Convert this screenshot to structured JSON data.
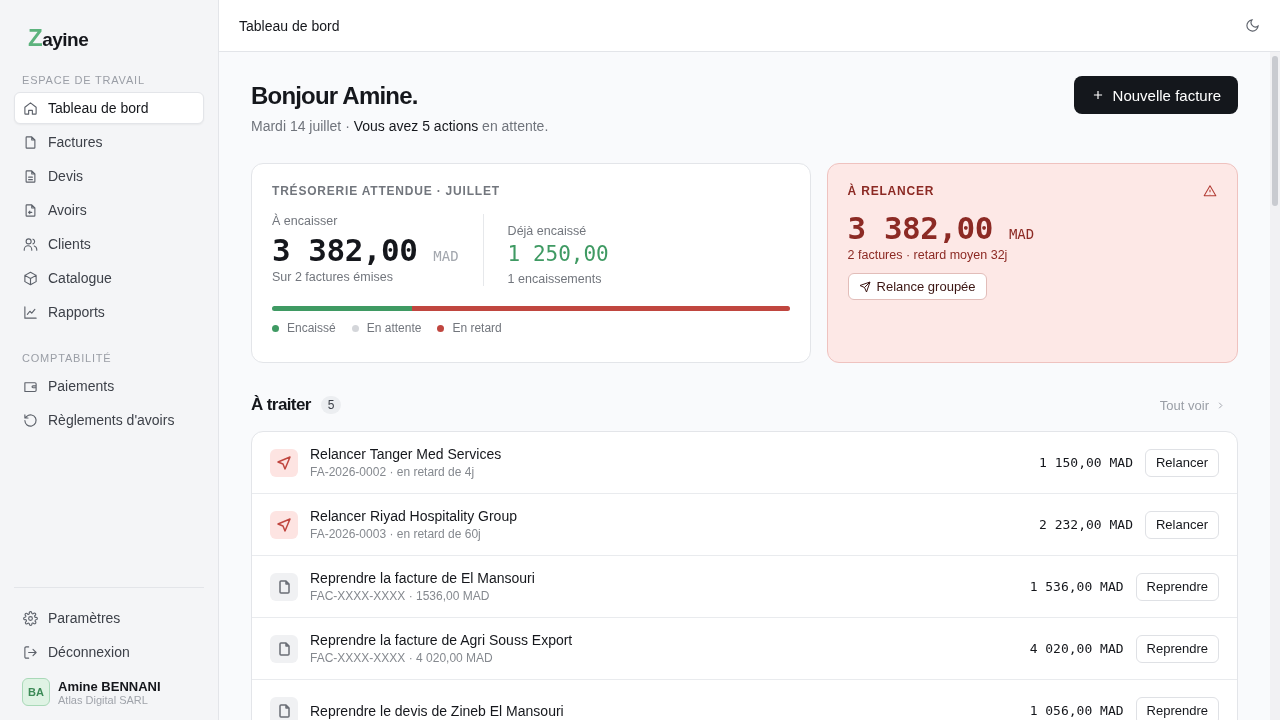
{
  "sidebar": {
    "logo": {
      "mark": "Z",
      "rest": "ayine"
    },
    "sections": [
      {
        "title": "ESPACE DE TRAVAIL",
        "items": [
          {
            "label": "Tableau de bord",
            "selected": true
          },
          {
            "label": "Factures",
            "selected": false
          },
          {
            "label": "Devis",
            "selected": false
          },
          {
            "label": "Avoirs",
            "selected": false
          },
          {
            "label": "Clients",
            "selected": false
          },
          {
            "label": "Catalogue",
            "selected": false
          },
          {
            "label": "Rapports",
            "selected": false
          }
        ]
      },
      {
        "title": "COMPTABILITÉ",
        "items": [
          {
            "label": "Paiements",
            "selected": false
          },
          {
            "label": "Règlements d'avoirs",
            "selected": false
          }
        ]
      }
    ],
    "footer": [
      {
        "label": "Paramètres"
      },
      {
        "label": "Déconnexion"
      }
    ],
    "user": {
      "initials": "BA",
      "name": "Amine BENNANI",
      "company": "Atlas Digital SARL"
    }
  },
  "topbar": {
    "title": "Tableau de bord"
  },
  "greeting": {
    "title": "Bonjour Amine.",
    "subtitle": "Mardi 14 juillet · **Vous avez 5 actions** en attente.",
    "button": "Nouvelle facture"
  },
  "treasury": {
    "title": "TRÉSORERIE ATTENDUE · JUILLET",
    "to_collect": {
      "label": "À encaisser",
      "amount": "3 382,00",
      "currency": "MAD",
      "note": "Sur 2 factures émises"
    },
    "collected": {
      "label": "Déjà encaissé",
      "amount": "1 250,00",
      "note": "1 encaissements"
    },
    "segments": [
      {
        "label": "Encaissé",
        "color": "#3f9a63",
        "level": 0.27
      },
      {
        "label": "En attente",
        "color": "#d4d6da",
        "level": 0
      },
      {
        "label": "En retard",
        "color": "#c0463f",
        "level": 0.73
      }
    ]
  },
  "reminder": {
    "title": "À RELANCER",
    "amount": "3 382,00",
    "currency": "MAD",
    "note": "2 factures · retard moyen 32j",
    "button": "Relance groupée"
  },
  "todo": {
    "title": "À traiter",
    "count": "5",
    "link": "Tout voir",
    "rows": [
      {
        "kind": "relance",
        "title": "Relancer Tanger Med Services",
        "sub": "FA-2026-0002 · en retard de 4j",
        "amount": "1 150,00 MAD",
        "action": "Relancer"
      },
      {
        "kind": "relance",
        "title": "Relancer Riyad Hospitality Group",
        "sub": "FA-2026-0003 · en retard de 60j",
        "amount": "2 232,00 MAD",
        "action": "Relancer"
      },
      {
        "kind": "reprise",
        "title": "Reprendre la facture de El Mansouri",
        "sub": "FAC-XXXX-XXXX · 1536,00 MAD",
        "amount": "1 536,00 MAD",
        "action": "Reprendre"
      },
      {
        "kind": "reprise",
        "title": "Reprendre la facture de Agri Souss Export",
        "sub": "FAC-XXXX-XXXX · 4 020,00 MAD",
        "amount": "4 020,00 MAD",
        "action": "Reprendre"
      },
      {
        "kind": "reprise",
        "title": "Reprendre le devis de Zineb El Mansouri",
        "amount": "1 056,00 MAD",
        "action": "Reprendre"
      }
    ]
  }
}
